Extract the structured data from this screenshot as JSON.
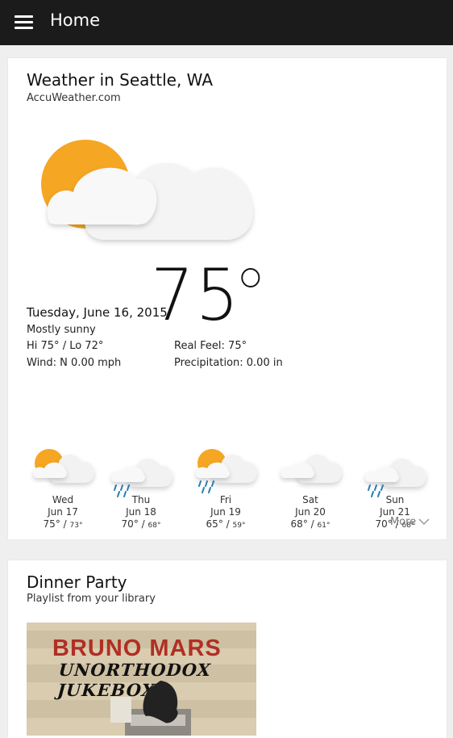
{
  "header": {
    "title": "Home"
  },
  "weather": {
    "title": "Weather in Seattle, WA",
    "source": "AccuWeather.com",
    "current_temp": "75",
    "date": "Tuesday, June 16, 2015",
    "condition": "Mostly sunny",
    "hi_lo": "Hi 75° / Lo 72°",
    "wind": "Wind: N 0.00 mph",
    "real_feel": "Real Feel: 75°",
    "precipitation": "Precipitation: 0.00 in",
    "more_label": "More",
    "forecast": [
      {
        "day": "Wed",
        "date": "Jun 17",
        "high": "75°",
        "low": "73°",
        "icon": "sun-cloud-icon"
      },
      {
        "day": "Thu",
        "date": "Jun 18",
        "high": "70°",
        "low": "68°",
        "icon": "rain-cloud-icon"
      },
      {
        "day": "Fri",
        "date": "Jun 19",
        "high": "65°",
        "low": "59°",
        "icon": "sun-rain-cloud-icon"
      },
      {
        "day": "Sat",
        "date": "Jun 20",
        "high": "68°",
        "low": "61°",
        "icon": "cloud-icon"
      },
      {
        "day": "Sun",
        "date": "Jun 21",
        "high": "70°",
        "low": "68°",
        "icon": "rain-cloud-icon"
      }
    ]
  },
  "playlist": {
    "title": "Dinner Party",
    "subtitle": "Playlist from your library",
    "album_artist": "BRUNO MARS",
    "album_name": "UNORTHODOX JUKEBOX"
  },
  "colors": {
    "header_bg": "#1b1b1b",
    "sun": "#f5a623",
    "rain": "#2b7fb3"
  }
}
